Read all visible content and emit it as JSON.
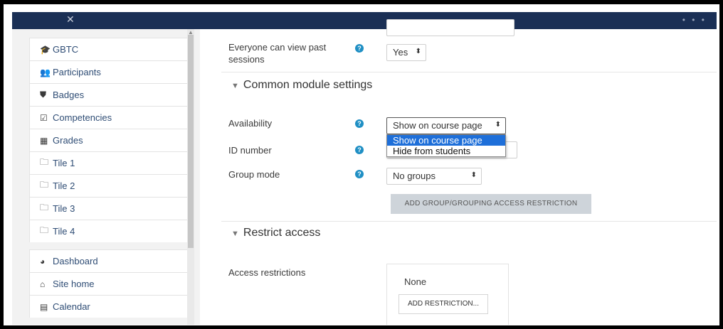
{
  "sidebar": {
    "course_items": [
      {
        "icon": "graduation-cap-icon",
        "glyph": "🎓",
        "label": "GBTC"
      },
      {
        "icon": "users-icon",
        "glyph": "👥",
        "label": "Participants"
      },
      {
        "icon": "shield-icon",
        "glyph": "⛊",
        "label": "Badges"
      },
      {
        "icon": "check-square-icon",
        "glyph": "☑",
        "label": "Competencies"
      },
      {
        "icon": "table-icon",
        "glyph": "▦",
        "label": "Grades"
      },
      {
        "icon": "folder-icon",
        "glyph": "🗀",
        "label": "Tile 1"
      },
      {
        "icon": "folder-icon",
        "glyph": "🗀",
        "label": "Tile 2"
      },
      {
        "icon": "folder-icon",
        "glyph": "🗀",
        "label": "Tile 3"
      },
      {
        "icon": "folder-icon",
        "glyph": "🗀",
        "label": "Tile 4"
      }
    ],
    "site_items": [
      {
        "icon": "dashboard-icon",
        "glyph": "◕",
        "label": "Dashboard"
      },
      {
        "icon": "home-icon",
        "glyph": "⌂",
        "label": "Site home"
      },
      {
        "icon": "calendar-icon",
        "glyph": "▤",
        "label": "Calendar"
      }
    ]
  },
  "form": {
    "view_past": {
      "label_line1": "Everyone can view past",
      "label_line2": "sessions",
      "value": "Yes"
    },
    "common_section": "Common module settings",
    "availability": {
      "label": "Availability",
      "value": "Show on course page",
      "options": [
        "Show on course page",
        "Hide from students"
      ],
      "selected_option": "Show on course page"
    },
    "id_number": {
      "label": "ID number",
      "value": ""
    },
    "group_mode": {
      "label": "Group mode",
      "value": "No groups"
    },
    "group_restriction_button": "ADD GROUP/GROUPING ACCESS RESTRICTION",
    "restrict_section": "Restrict access",
    "access_restrictions": {
      "label": "Access restrictions",
      "value": "None",
      "button": "ADD RESTRICTION..."
    }
  },
  "colors": {
    "topbar": "#1a2f55",
    "help_icon": "#1f8fc4",
    "dropdown_highlight": "#1e6fd9",
    "link_text": "#2f4d75"
  }
}
